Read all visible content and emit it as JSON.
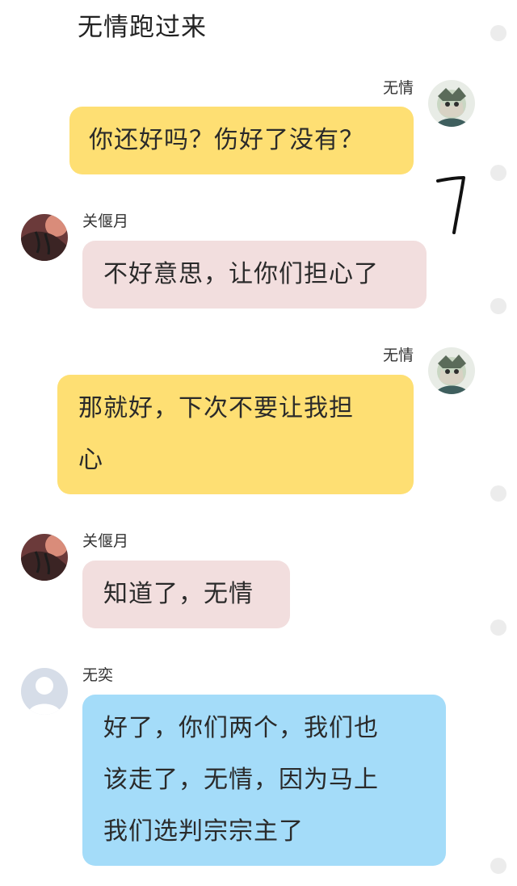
{
  "header": {
    "title": "无情跑过来"
  },
  "messages": [
    {
      "sender": "无情",
      "side": "right",
      "color": "yellow",
      "text": "你还好吗？伤好了没有？",
      "avatar": "wuqing-avatar"
    },
    {
      "sender": "关偃月",
      "side": "left",
      "color": "pink",
      "text": "不好意思，让你们担心了",
      "avatar": "guanyanyue-avatar"
    },
    {
      "sender": "无情",
      "side": "right",
      "color": "yellow",
      "text": "那就好，下次不要让我担\n心",
      "avatar": "wuqing-avatar"
    },
    {
      "sender": "关偃月",
      "side": "left",
      "color": "pink",
      "text": "知道了，无情",
      "avatar": "guanyanyue-avatar"
    },
    {
      "sender": "无奕",
      "side": "left",
      "color": "blue",
      "text": "好了，你们两个，我们也\n该走了，无情，因为马上\n我们选判宗宗主了",
      "avatar": "default-avatar"
    }
  ],
  "colors": {
    "yellow_bubble": "#fedf73",
    "pink_bubble": "#f2dede",
    "blue_bubble": "#a4dcf9",
    "scroll_dot": "#ececec"
  }
}
